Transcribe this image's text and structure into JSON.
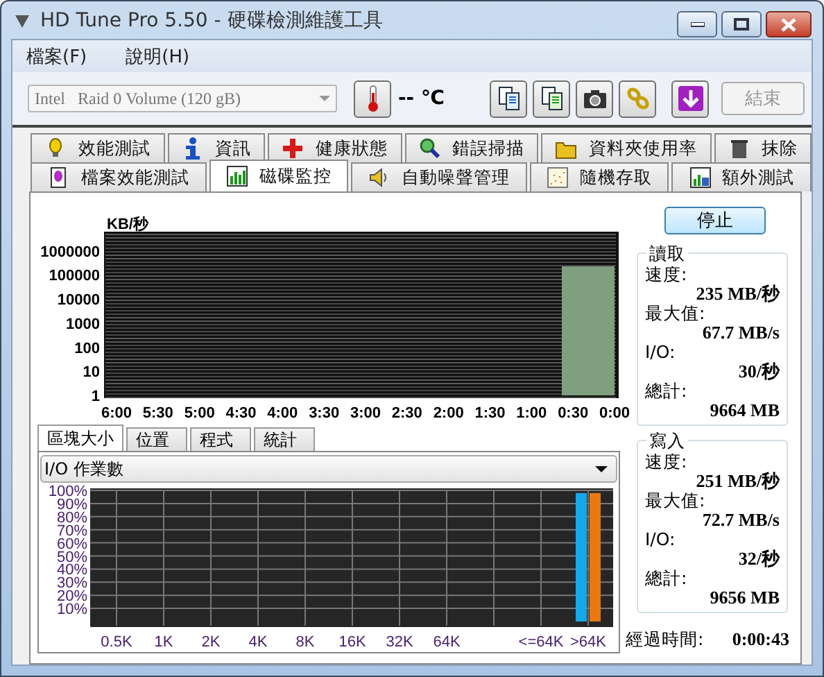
{
  "window": {
    "title": "HD Tune Pro 5.50 - 硬碟檢測維護工具"
  },
  "menu": [
    {
      "label": "檔案(F)"
    },
    {
      "label": "說明(H)"
    }
  ],
  "toolbar": {
    "drive": {
      "value": "Intel   Raid 0 Volume (120 gB)",
      "disabled": true
    },
    "temperature": "-- ℃",
    "exit_button": {
      "label": "結束",
      "disabled": true
    }
  },
  "tab_rows": [
    {
      "tabs": [
        {
          "label": "效能測試",
          "selected": false
        },
        {
          "label": "資訊",
          "selected": false
        },
        {
          "label": "健康狀態",
          "selected": false
        },
        {
          "label": "錯誤掃描",
          "selected": false
        },
        {
          "label": "資料夾使用率",
          "selected": false
        },
        {
          "label": "抹除",
          "selected": false
        }
      ]
    },
    {
      "tabs": [
        {
          "label": "檔案效能測試",
          "selected": false
        },
        {
          "label": "磁碟監控",
          "selected": true
        },
        {
          "label": "自動噪聲管理",
          "selected": false
        },
        {
          "label": "隨機存取",
          "selected": false
        },
        {
          "label": "額外測試",
          "selected": false
        }
      ]
    }
  ],
  "monitor": {
    "unit": "KB/秒",
    "x_labels": [
      "6:00",
      "5:30",
      "5:00",
      "4:30",
      "4:00",
      "3:30",
      "3:00",
      "2:30",
      "2:00",
      "1:30",
      "1:00",
      "0:30",
      "0:00"
    ],
    "y_labels": [
      "1000000",
      "100000",
      "10000",
      "1000",
      "100",
      "10",
      "1"
    ]
  },
  "sub_tabs": [
    {
      "label": "區塊大小",
      "selected": true
    },
    {
      "label": "位置",
      "selected": false
    },
    {
      "label": "程式",
      "selected": false
    },
    {
      "label": "統計",
      "selected": false
    }
  ],
  "dropdown": {
    "value": "I/O 作業數"
  },
  "block_chart": {
    "chart_data": {
      "type": "bar",
      "categories": [
        "0.5K",
        "1K",
        "2K",
        "4K",
        "8K",
        "16K",
        "32K",
        "64K",
        "<=64K",
        ">64K"
      ],
      "series": [
        {
          "color": "#16a8e8",
          "values": [
            null,
            null,
            null,
            null,
            null,
            null,
            null,
            null,
            null,
            98
          ]
        },
        {
          "color": "#e8780f",
          "values": [
            null,
            null,
            null,
            null,
            null,
            null,
            null,
            null,
            null,
            98
          ]
        }
      ],
      "ylim": [
        0,
        100
      ],
      "grid": true,
      "yticks": [
        {
          "value": 10,
          "label": "10%"
        },
        {
          "value": 20,
          "label": "20%"
        },
        {
          "value": 30,
          "label": "30%"
        },
        {
          "value": 40,
          "label": "40%"
        },
        {
          "value": 50,
          "label": "50%"
        },
        {
          "value": 60,
          "label": "60%"
        },
        {
          "value": 70,
          "label": "70%"
        },
        {
          "value": 80,
          "label": "80%"
        },
        {
          "value": 90,
          "label": "90%"
        },
        {
          "value": 100,
          "label": "100%"
        }
      ]
    }
  },
  "stop_button": {
    "label": "停止"
  },
  "read": {
    "title": "讀取",
    "fields": [
      {
        "label": "速度:",
        "value": "235 MB/秒"
      },
      {
        "label": "最大值:",
        "value": "67.7 MB/s"
      },
      {
        "label": "I/O:",
        "value": "30/秒"
      },
      {
        "label": "總計:",
        "value": "9664 MB"
      }
    ]
  },
  "write": {
    "title": "寫入",
    "fields": [
      {
        "label": "速度:",
        "value": "251 MB/秒"
      },
      {
        "label": "最大值:",
        "value": "72.7 MB/s"
      },
      {
        "label": "I/O:",
        "value": "32/秒"
      },
      {
        "label": "總計:",
        "value": "9656 MB"
      }
    ]
  },
  "elapsed": {
    "label": "經過時間:",
    "value": "0:00:43"
  }
}
